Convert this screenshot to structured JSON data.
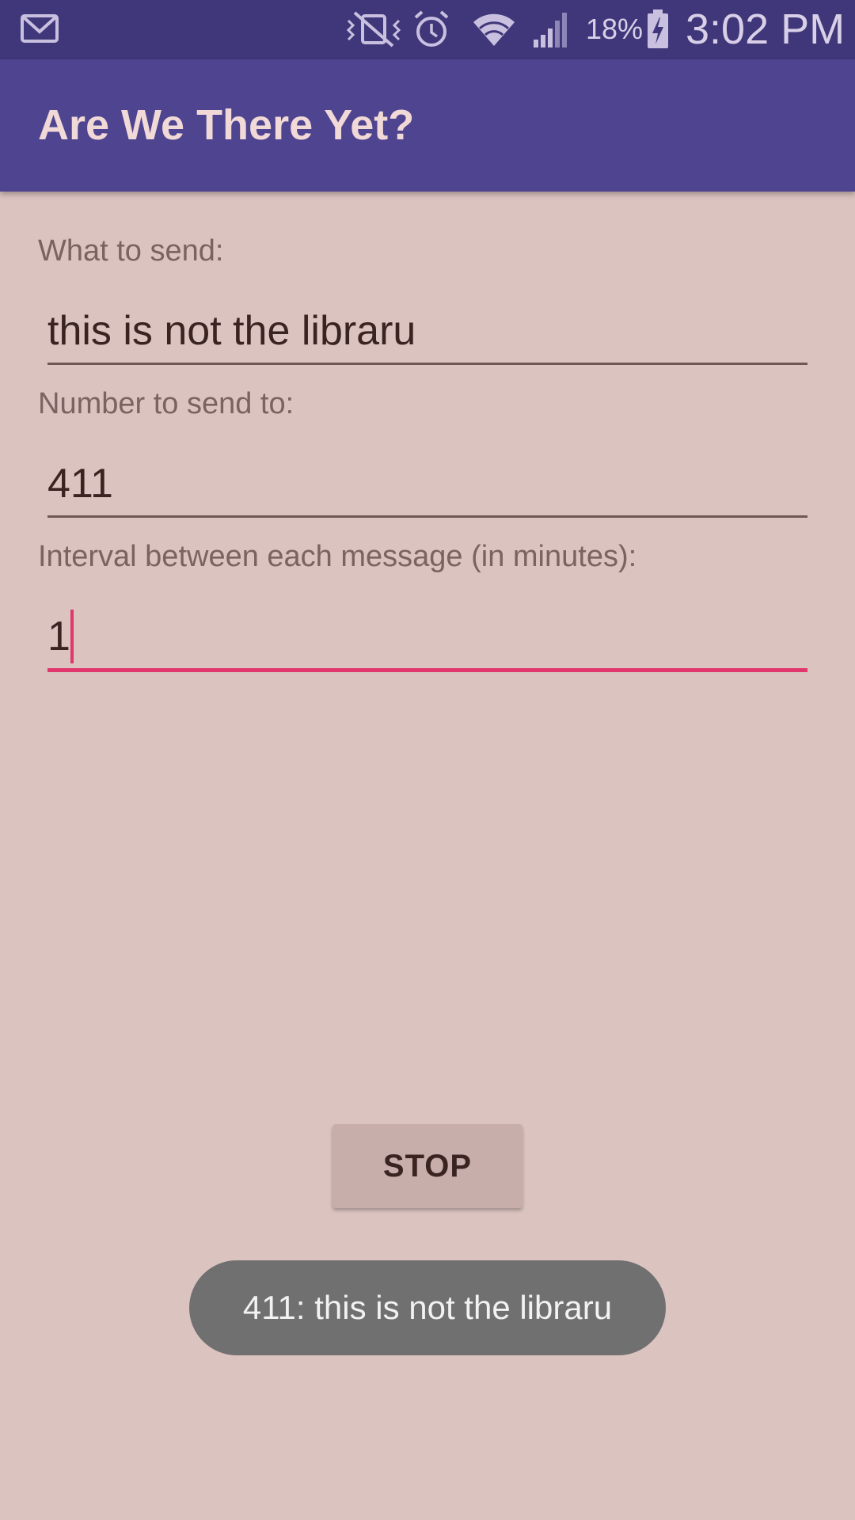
{
  "status_bar": {
    "battery_percent": "18%",
    "time": "3:02 PM",
    "icons": [
      "gmail-icon",
      "vibrate-mute-icon",
      "alarm-icon",
      "wifi-icon",
      "signal-icon",
      "battery-charging-icon"
    ]
  },
  "app_bar": {
    "title": "Are We There Yet?"
  },
  "form": {
    "message_label": "What to send:",
    "message_value": "this is not the libraru",
    "number_label": "Number to send to:",
    "number_value": "411",
    "interval_label": "Interval between each message (in minutes):",
    "interval_value": "1"
  },
  "stop_button": {
    "label": "STOP"
  },
  "toast": {
    "text": "411: this is not the libraru"
  },
  "colors": {
    "status_bar": "#40377a",
    "app_bar": "#4f4490",
    "background": "#dbc3bf",
    "accent": "#e0386c",
    "toast": "#707070"
  }
}
